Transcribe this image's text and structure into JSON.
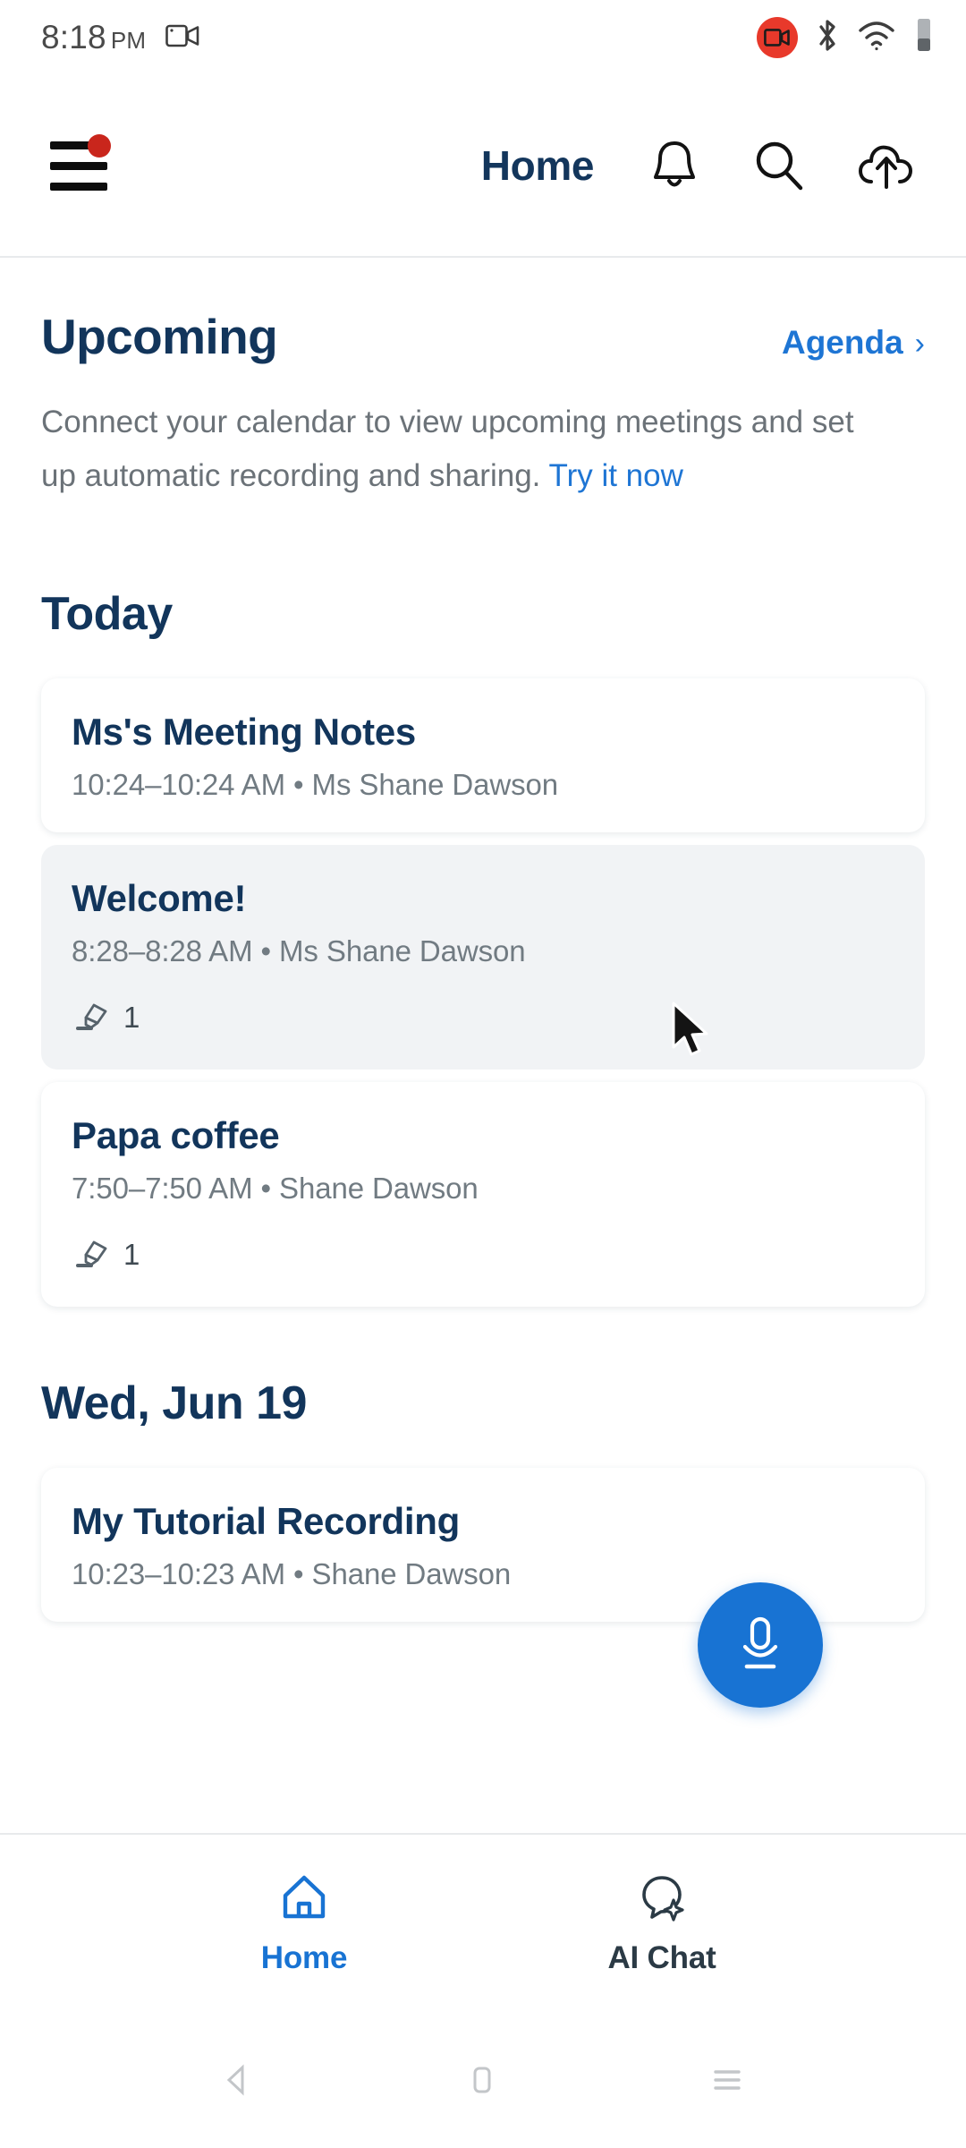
{
  "status_bar": {
    "time": "8:18",
    "ampm": "PM",
    "left_icon": "video-camera-icon",
    "right_icons": [
      "screen-record-icon",
      "bluetooth-icon",
      "wifi-icon",
      "battery-icon"
    ]
  },
  "header": {
    "menu_icon": "hamburger-menu-icon",
    "menu_badge": true,
    "title": "Home",
    "actions": [
      {
        "icon": "bell-icon",
        "name": "notifications-button"
      },
      {
        "icon": "search-icon",
        "name": "search-button"
      },
      {
        "icon": "cloud-upload-icon",
        "name": "upload-button"
      }
    ]
  },
  "upcoming": {
    "title": "Upcoming",
    "agenda_label": "Agenda",
    "agenda_chevron": "›",
    "blurb_text": "Connect your calendar to view upcoming meetings and set up automatic recording and sharing.",
    "blurb_cta": "Try it now"
  },
  "groups": [
    {
      "day_label": "Today",
      "items": [
        {
          "title": "Ms's Meeting Notes",
          "meta": "10:24–10:24 AM  •  Ms Shane Dawson",
          "highlights": null,
          "hovered": false
        },
        {
          "title": "Welcome!",
          "meta": "8:28–8:28 AM  •  Ms Shane Dawson",
          "highlights": "1",
          "hovered": true
        },
        {
          "title": "Papa coffee",
          "meta": "7:50–7:50 AM  •  Shane Dawson",
          "highlights": "1",
          "hovered": false
        }
      ]
    },
    {
      "day_label": "Wed, Jun 19",
      "items": [
        {
          "title": "My Tutorial Recording",
          "meta": "10:23–10:23 AM  •  Shane Dawson",
          "highlights": null,
          "hovered": false
        }
      ]
    }
  ],
  "fab": {
    "icon": "microphone-icon",
    "color": "#1873d3"
  },
  "bottom_nav": {
    "items": [
      {
        "label": "Home",
        "icon": "home-icon",
        "active": true
      },
      {
        "label": "AI Chat",
        "icon": "ai-chat-bubble-icon",
        "active": false
      }
    ]
  },
  "system_nav": {
    "back": "back-triangle-icon",
    "home": "home-square-icon",
    "recents": "recents-lines-icon"
  },
  "colors": {
    "accent_blue": "#1873d3",
    "link_blue": "#1e75d4",
    "heading_navy": "#12355b",
    "muted_grey": "#6b7278",
    "badge_red": "#c9261c",
    "hover_card": "#f1f3f5"
  }
}
